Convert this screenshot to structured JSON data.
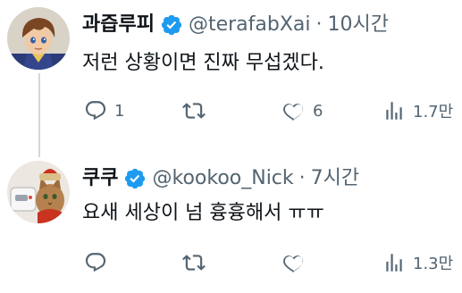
{
  "colors": {
    "text_primary": "#0f1419",
    "text_secondary": "#536471",
    "verified_blue": "#1d9bf0",
    "thread_line": "#cfd9de"
  },
  "tweets": [
    {
      "display_name": "과즙루피",
      "handle": "@terafabXai",
      "separator": "·",
      "time": "10시간",
      "text": "저런 상황이면 진짜 무섭겠다.",
      "replies": "1",
      "retweets": "",
      "likes": "6",
      "views": "1.7만",
      "icons": [
        "reply-icon",
        "retweet-icon",
        "like-icon",
        "views-icon",
        "verified-badge-icon"
      ]
    },
    {
      "display_name": "쿠쿠",
      "handle": "@kookoo_Nick",
      "separator": "·",
      "time": "7시간",
      "text": "요새 세상이 넘 흉흉해서 ㅠㅠ",
      "replies": "",
      "retweets": "",
      "likes": "",
      "views": "1.3만",
      "icons": [
        "reply-icon",
        "retweet-icon",
        "like-icon",
        "views-icon",
        "verified-badge-icon"
      ]
    }
  ]
}
